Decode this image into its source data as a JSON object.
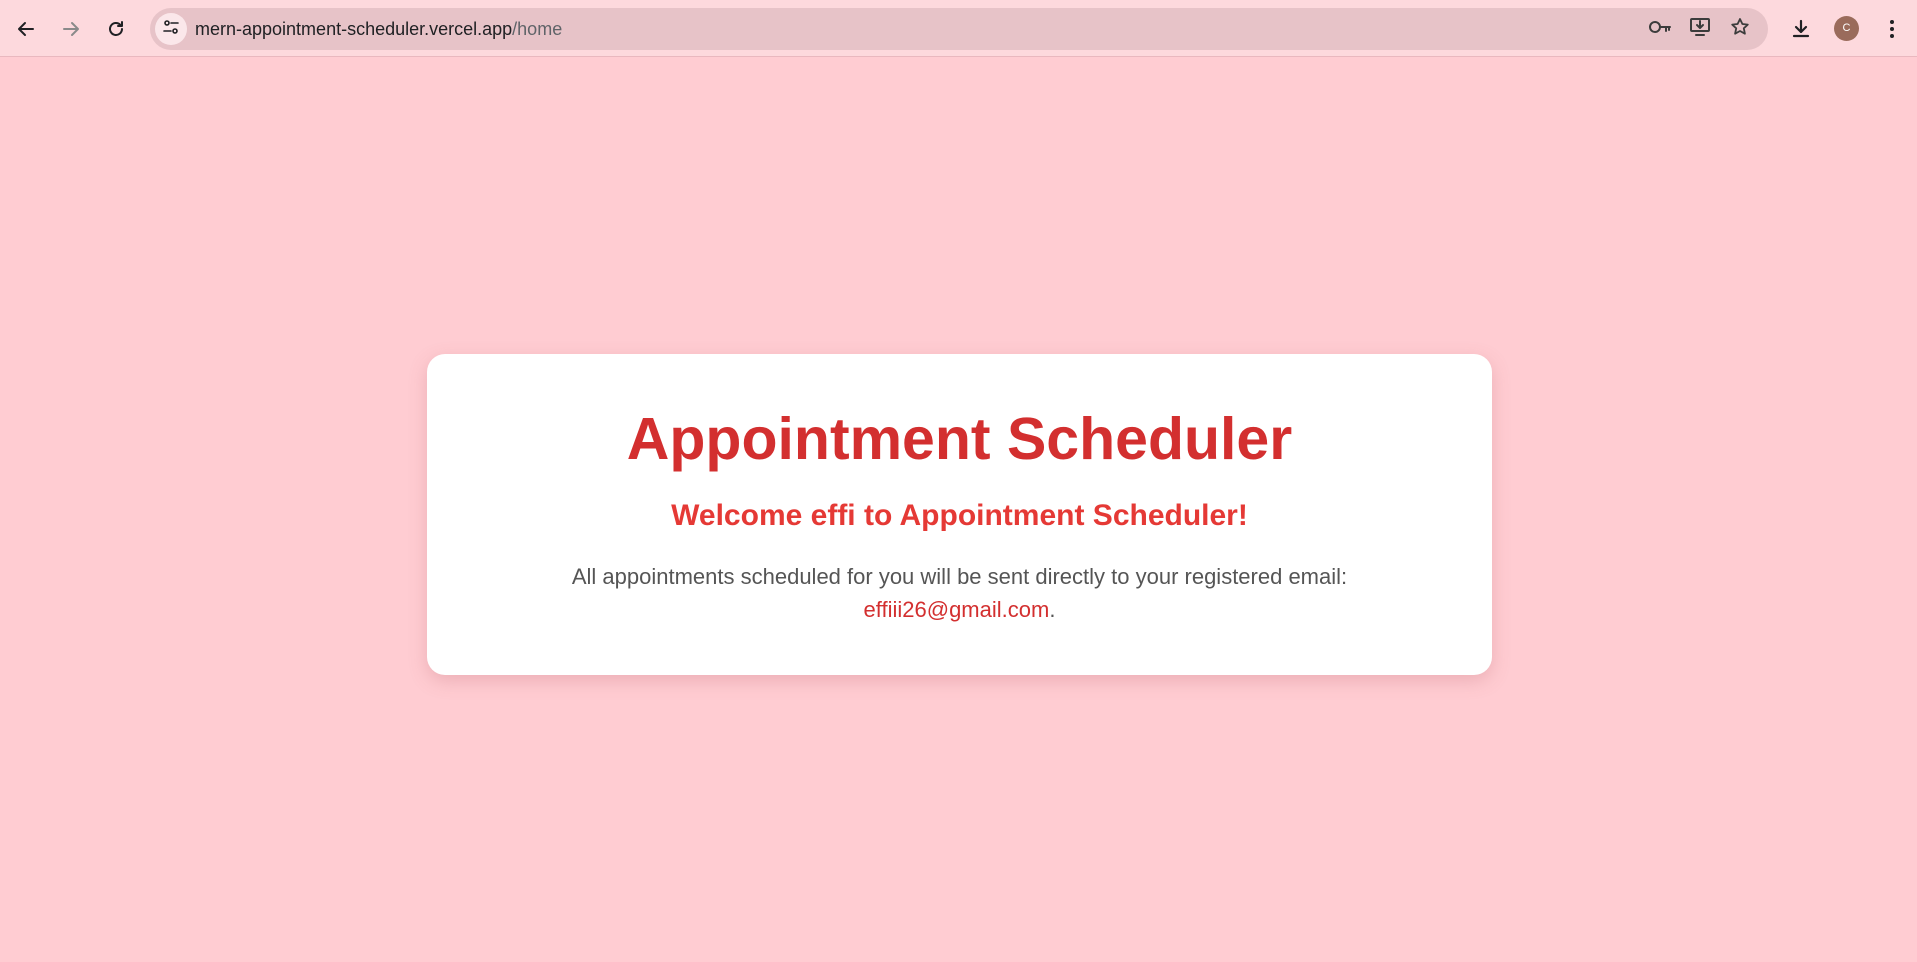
{
  "browser": {
    "url_host": "mern-appointment-scheduler.vercel.app",
    "url_path": "/home",
    "profile_initial": "C",
    "icons": {
      "back": "arrow-left-icon",
      "forward": "arrow-right-icon",
      "reload": "reload-icon",
      "site_info": "tune-icon",
      "password": "key-icon",
      "install": "install-app-icon",
      "bookmark": "star-icon",
      "downloads": "download-icon",
      "menu": "kebab-menu-icon"
    }
  },
  "page": {
    "title": "Appointment Scheduler",
    "welcome": "Welcome effi to Appointment Scheduler!",
    "message": "All appointments scheduled for you will be sent directly to your registered email:",
    "email": "effiii26@gmail.com",
    "trailing_punctuation": "."
  },
  "colors": {
    "page_background": "#ffccd2",
    "card_background": "#ffffff",
    "title": "#d32f2f",
    "subtitle": "#e53935",
    "body_text": "#555555",
    "email": "#d32f2f"
  }
}
